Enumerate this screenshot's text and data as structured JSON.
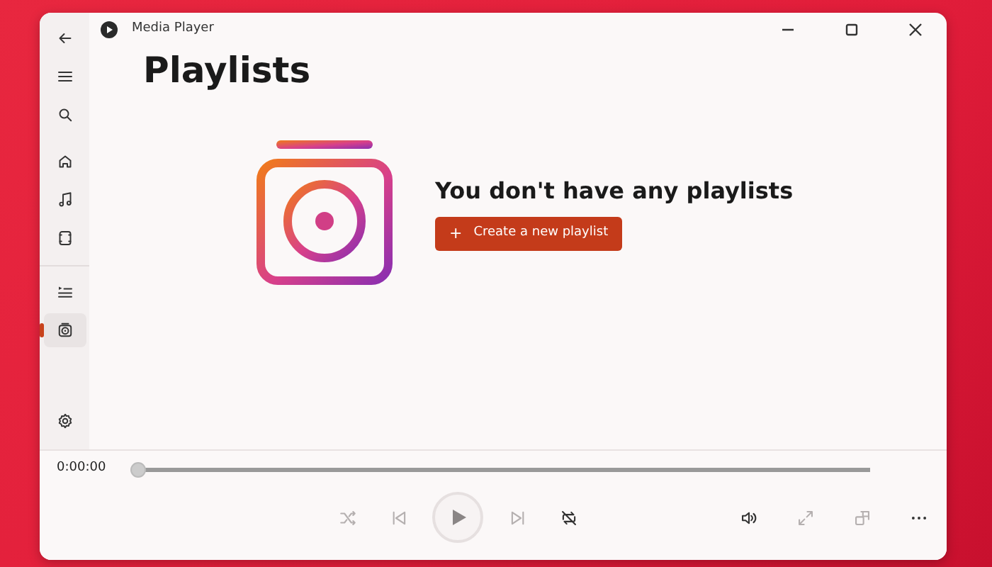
{
  "window": {
    "title": "Media Player"
  },
  "nav": [
    {
      "kind": "back",
      "selected": false
    },
    {
      "kind": "menu",
      "selected": false
    },
    {
      "kind": "search",
      "selected": false
    },
    {
      "kind": "home",
      "selected": false
    },
    {
      "kind": "music",
      "selected": false
    },
    {
      "kind": "video",
      "selected": false
    },
    {
      "kind": "queue",
      "selected": false
    },
    {
      "kind": "playlists",
      "selected": true
    }
  ],
  "settings": {
    "kind": "settings"
  },
  "page": {
    "title": "Playlists",
    "empty_message": "You don't have any playlists",
    "create_button": {
      "icon": "+",
      "label": "Create a new playlist"
    }
  },
  "player": {
    "time": "0:00:00",
    "seek": {
      "level": 0
    },
    "controls": [
      {
        "kind": "shuffle",
        "disabled": true
      },
      {
        "kind": "previous",
        "disabled": true
      },
      {
        "kind": "play",
        "disabled": false
      },
      {
        "kind": "next",
        "disabled": true
      },
      {
        "kind": "repeat",
        "disabled": false
      }
    ],
    "side_controls": [
      {
        "kind": "volume",
        "disabled": false
      },
      {
        "kind": "fullscreen",
        "disabled": true
      },
      {
        "kind": "miniplayer",
        "disabled": true
      },
      {
        "kind": "more",
        "disabled": false
      }
    ]
  }
}
